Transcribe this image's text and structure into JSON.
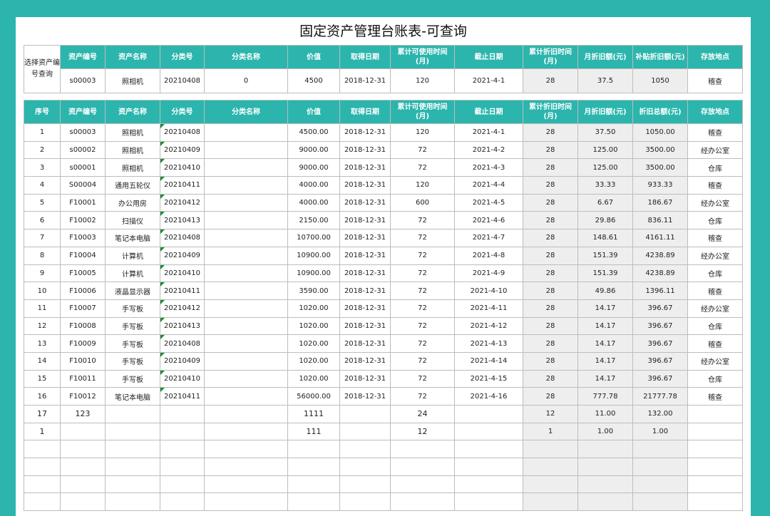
{
  "title": "固定资产管理台账表-可查询",
  "query": {
    "label": "选择资产编号查询",
    "headers": [
      "资产编号",
      "资产名称",
      "分类号",
      "分类名称",
      "价值",
      "取得日期",
      "累计可使用时间(月)",
      "截止日期",
      "累计折旧时间(月)",
      "月折旧额(元)",
      "补贴折旧额(元)",
      "存放地点"
    ],
    "values": [
      "s00003",
      "照相机",
      "20210408",
      "0",
      "4500",
      "2018-12-31",
      "120",
      "2021-4-1",
      "28",
      "37.5",
      "1050",
      "稽查"
    ]
  },
  "table": {
    "headers": [
      "序号",
      "资产编号",
      "资产名称",
      "分类号",
      "分类名称",
      "价值",
      "取得日期",
      "累计可使用时间(月)",
      "截止日期",
      "累计折旧时间(月)",
      "月折旧额(元)",
      "折旧总额(元)",
      "存放地点"
    ],
    "rows": [
      [
        "1",
        "s00003",
        "照相机",
        "20210408",
        "",
        "4500.00",
        "2018-12-31",
        "120",
        "2021-4-1",
        "28",
        "37.50",
        "1050.00",
        "稽查"
      ],
      [
        "2",
        "s00002",
        "照相机",
        "20210409",
        "",
        "9000.00",
        "2018-12-31",
        "72",
        "2021-4-2",
        "28",
        "125.00",
        "3500.00",
        "经办公室"
      ],
      [
        "3",
        "s00001",
        "照相机",
        "20210410",
        "",
        "9000.00",
        "2018-12-31",
        "72",
        "2021-4-3",
        "28",
        "125.00",
        "3500.00",
        "仓库"
      ],
      [
        "4",
        "S00004",
        "通用五轮仪",
        "20210411",
        "",
        "4000.00",
        "2018-12-31",
        "120",
        "2021-4-4",
        "28",
        "33.33",
        "933.33",
        "稽查"
      ],
      [
        "5",
        "F10001",
        "办公用房",
        "20210412",
        "",
        "4000.00",
        "2018-12-31",
        "600",
        "2021-4-5",
        "28",
        "6.67",
        "186.67",
        "经办公室"
      ],
      [
        "6",
        "F10002",
        "扫描仪",
        "20210413",
        "",
        "2150.00",
        "2018-12-31",
        "72",
        "2021-4-6",
        "28",
        "29.86",
        "836.11",
        "仓库"
      ],
      [
        "7",
        "F10003",
        "笔记本电脑",
        "20210408",
        "",
        "10700.00",
        "2018-12-31",
        "72",
        "2021-4-7",
        "28",
        "148.61",
        "4161.11",
        "稽查"
      ],
      [
        "8",
        "F10004",
        "计算机",
        "20210409",
        "",
        "10900.00",
        "2018-12-31",
        "72",
        "2021-4-8",
        "28",
        "151.39",
        "4238.89",
        "经办公室"
      ],
      [
        "9",
        "F10005",
        "计算机",
        "20210410",
        "",
        "10900.00",
        "2018-12-31",
        "72",
        "2021-4-9",
        "28",
        "151.39",
        "4238.89",
        "仓库"
      ],
      [
        "10",
        "F10006",
        "液晶显示器",
        "20210411",
        "",
        "3590.00",
        "2018-12-31",
        "72",
        "2021-4-10",
        "28",
        "49.86",
        "1396.11",
        "稽查"
      ],
      [
        "11",
        "F10007",
        "手写板",
        "20210412",
        "",
        "1020.00",
        "2018-12-31",
        "72",
        "2021-4-11",
        "28",
        "14.17",
        "396.67",
        "经办公室"
      ],
      [
        "12",
        "F10008",
        "手写板",
        "20210413",
        "",
        "1020.00",
        "2018-12-31",
        "72",
        "2021-4-12",
        "28",
        "14.17",
        "396.67",
        "仓库"
      ],
      [
        "13",
        "F10009",
        "手写板",
        "20210408",
        "",
        "1020.00",
        "2018-12-31",
        "72",
        "2021-4-13",
        "28",
        "14.17",
        "396.67",
        "稽查"
      ],
      [
        "14",
        "F10010",
        "手写板",
        "20210409",
        "",
        "1020.00",
        "2018-12-31",
        "72",
        "2021-4-14",
        "28",
        "14.17",
        "396.67",
        "经办公室"
      ],
      [
        "15",
        "F10011",
        "手写板",
        "20210410",
        "",
        "1020.00",
        "2018-12-31",
        "72",
        "2021-4-15",
        "28",
        "14.17",
        "396.67",
        "仓库"
      ],
      [
        "16",
        "F10012",
        "笔记本电脑",
        "20210411",
        "",
        "56000.00",
        "2018-12-31",
        "72",
        "2021-4-16",
        "28",
        "777.78",
        "21777.78",
        "稽查"
      ],
      [
        "17",
        "123",
        "",
        "",
        "",
        "1111",
        "",
        "24",
        "",
        "12",
        "11.00",
        "132.00",
        ""
      ],
      [
        "1",
        "",
        "",
        "",
        "",
        "111",
        "",
        "12",
        "",
        "1",
        "1.00",
        "1.00",
        ""
      ],
      [
        "",
        "",
        "",
        "",
        "",
        "",
        "",
        "",
        "",
        "",
        "",
        "",
        ""
      ],
      [
        "",
        "",
        "",
        "",
        "",
        "",
        "",
        "",
        "",
        "",
        "",
        "",
        ""
      ],
      [
        "",
        "",
        "",
        "",
        "",
        "",
        "",
        "",
        "",
        "",
        "",
        "",
        ""
      ],
      [
        "",
        "",
        "",
        "",
        "",
        "",
        "",
        "",
        "",
        "",
        "",
        "",
        ""
      ]
    ]
  },
  "colors": {
    "accent": "#2bb5ad",
    "header_text": "#ffffff",
    "shaded": "#eeeeee",
    "flag": "#1f8a3a"
  }
}
